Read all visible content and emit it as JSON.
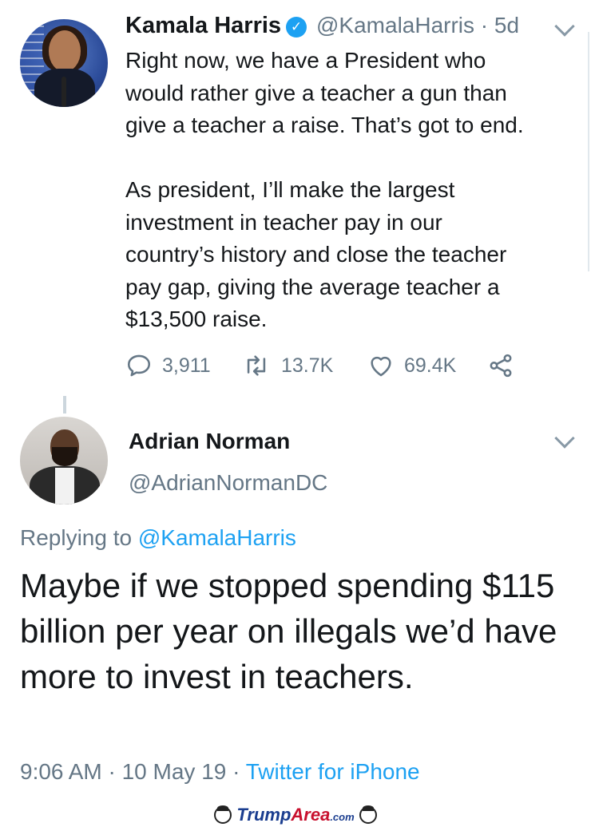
{
  "tweet": {
    "display_name": "Kamala Harris",
    "verified_glyph": "✓",
    "handle_time": "@KamalaHarris · 5d",
    "text": "Right now, we have a President who\nwould rather give a teacher a gun than\ngive a teacher a raise. That’s got to end.\n\nAs president, I’ll make the largest\ninvestment in teacher pay in our\ncountry’s history and close the teacher\npay gap, giving the average teacher a\n$13,500 raise.",
    "actions": {
      "replies": "3,911",
      "retweets": "13.7K",
      "likes": "69.4K"
    }
  },
  "reply": {
    "display_name": "Adrian Norman",
    "handle": "@AdrianNormanDC",
    "replying_prefix": "Replying to",
    "replying_to": "@KamalaHarris",
    "text": "Maybe if we stopped spending $115 billion per year on illegals we’d have more to invest in teachers.",
    "timestamp": "9:06 AM · 10 May 19 · ",
    "source": "Twitter for iPhone"
  },
  "watermark": {
    "part1": "Trump",
    "part2": "Area",
    "part3": ".com"
  },
  "colors": {
    "text": "#14171a",
    "secondary": "#657786",
    "link": "#1da1f2",
    "icon": "#657786"
  },
  "icons": [
    "verified-badge-icon",
    "chevron-down-icon",
    "reply-icon",
    "retweet-icon",
    "like-icon",
    "share-icon"
  ]
}
